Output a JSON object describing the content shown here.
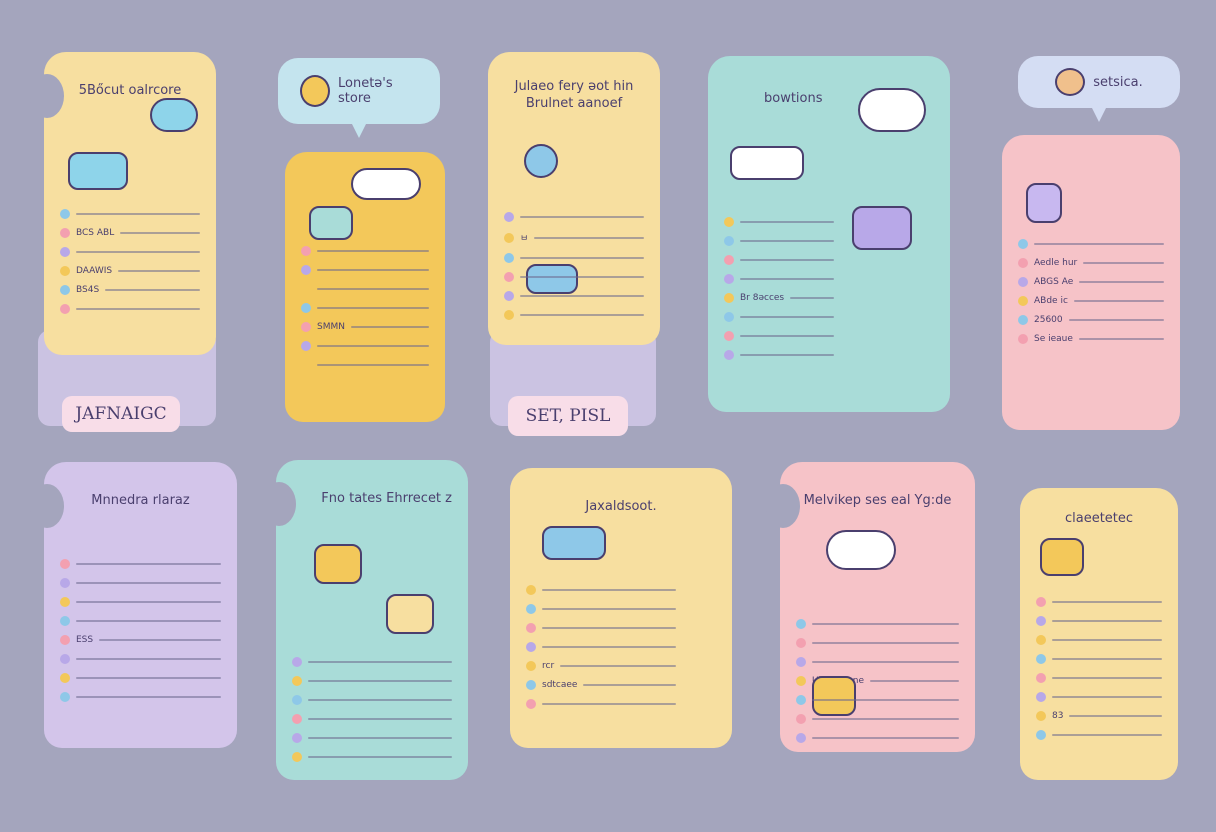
{
  "colors": {
    "background": "#a4a5bd",
    "yellow": "#f7dfa0",
    "gold": "#f3c85a",
    "teal": "#a9dcd8",
    "pink": "#f6c3c8",
    "lavender": "#d3c5ea",
    "sky": "#c4e4ee",
    "periwinkle": "#d4ddf3"
  },
  "cards": [
    {
      "title": "5Bőcut oalrcore",
      "rows": [
        "",
        "BCS ABL",
        "",
        "DAAWIS",
        "BS4S",
        ""
      ]
    },
    {
      "bubble": "Lonetǝ's store",
      "rows": [
        "",
        "",
        "",
        "",
        "SMMN",
        "",
        ""
      ]
    },
    {
      "title": "Julaeo fery ǝot  hin Brulnet aanoef",
      "rows": [
        "",
        "ㅂ",
        "",
        "",
        "",
        ""
      ]
    },
    {
      "title": "bowtions",
      "rows": [
        "",
        "",
        "",
        "",
        "Br 8ǝcces",
        "",
        "",
        ""
      ]
    },
    {
      "bubble": "setsica.",
      "rows": [
        "",
        "Aedle hur",
        "ABGS Ae",
        "ABde ic",
        "25600",
        "Se ieaue"
      ]
    },
    {
      "title": "Mnnedra rlaraz",
      "rows": [
        "",
        "",
        "",
        "",
        "ESS",
        "",
        "",
        ""
      ]
    },
    {
      "title": "Fno tates Ehrrecet z",
      "rows": [
        "",
        "",
        "",
        "",
        "",
        ""
      ]
    },
    {
      "title": "Jaxaldsoot.",
      "rows": [
        "",
        "",
        "",
        "",
        "rcr",
        "sdtcaee",
        ""
      ]
    },
    {
      "title": "Melvikep ses eal Yg:de",
      "rows": [
        "",
        "",
        "",
        "Uker Beane",
        "",
        "",
        ""
      ]
    },
    {
      "title": "claeetetec",
      "rows": [
        "",
        "",
        "",
        "",
        "",
        "",
        "83",
        ""
      ]
    }
  ],
  "labels": {
    "pill_1": "JAFNAIGC",
    "pill_2": "SET, PISL"
  }
}
